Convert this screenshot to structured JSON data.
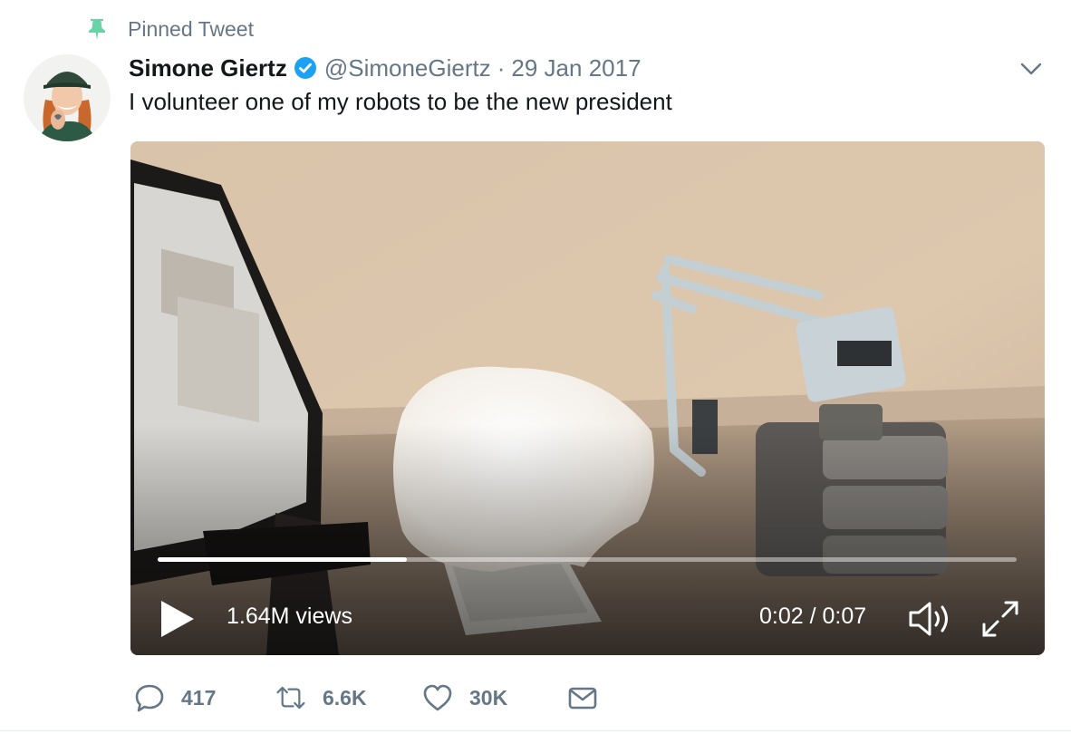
{
  "pinned": {
    "label": "Pinned Tweet",
    "icon": "pin-icon"
  },
  "tweet": {
    "author": {
      "display_name": "Simone Giertz",
      "handle": "@SimoneGiertz",
      "verified": true
    },
    "separator": "·",
    "date": "29 Jan 2017",
    "text": "I volunteer one of my robots to be the new president"
  },
  "video": {
    "views": "1.64M views",
    "time": "0:02 / 0:07",
    "progress": 0.29
  },
  "actions": {
    "replies": "417",
    "retweets": "6.6K",
    "likes": "30K"
  },
  "colors": {
    "accent": "#1da1f2",
    "pin": "#66d4a4",
    "muted": "#657786",
    "text": "#14171a"
  }
}
